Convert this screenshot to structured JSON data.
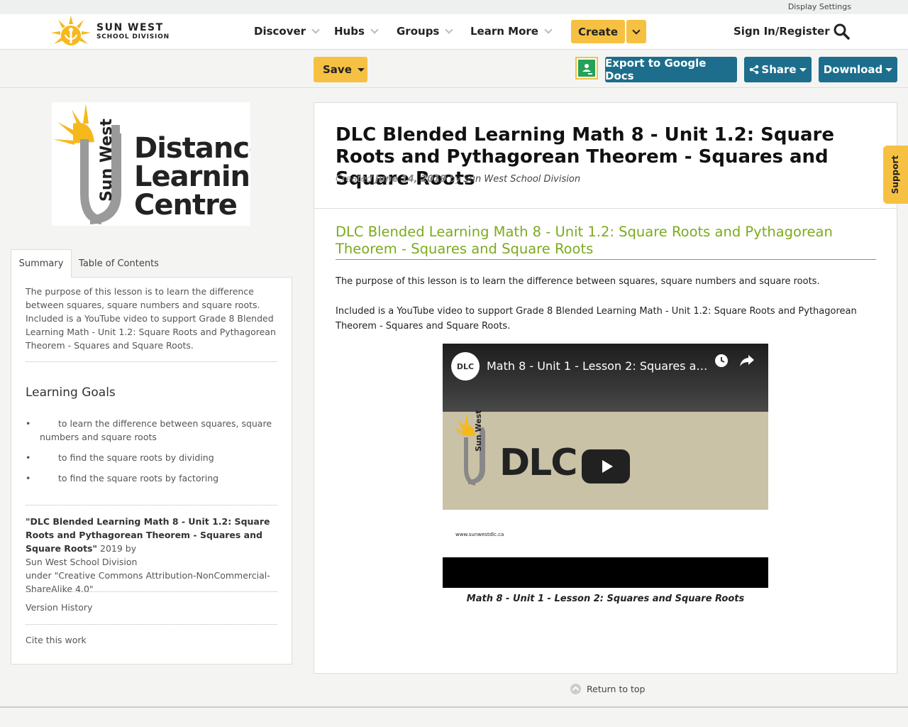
{
  "topbar": {
    "display_settings": "Display Settings"
  },
  "logo": {
    "line1": "SUN WEST",
    "line2": "SCHOOL DIVISION"
  },
  "nav": {
    "discover": "Discover",
    "hubs": "Hubs",
    "groups": "Groups",
    "learn_more": "Learn More",
    "create": "Create",
    "signin": "Sign In/Register"
  },
  "toolbar": {
    "save": "Save",
    "export": "Export to Google Docs",
    "share": "Share",
    "download": "Download"
  },
  "dlc_logo": {
    "sun_west": "Sun West",
    "line1": "Distance",
    "line2": "Learning",
    "line3": "Centre"
  },
  "tabs": {
    "summary": "Summary",
    "toc": "Table of Contents"
  },
  "sidebar": {
    "summary_text": "The purpose of this lesson is to learn the difference between squares, square numbers and square roots. Included is a YouTube video to support Grade 8 Blended Learning Math - Unit 1.2: Square Roots and Pythagorean Theorem - Squares and Square Roots.",
    "learning_goals_title": "Learning Goals",
    "goals": [
      "to learn the difference between squares, square numbers and square roots",
      "to find the square roots by dividing",
      "to find the square roots by factoring"
    ],
    "license_title": "\"DLC Blended Learning Math 8 - Unit 1.2: Square Roots and Pythagorean Theorem - Squares and Square Roots\"",
    "license_year_by": " 2019 by",
    "license_author": "Sun West School Division",
    "license_under": "under \"Creative Commons Attribution-NonCommercial-ShareAlike 4.0\"",
    "version_history": "Version History",
    "cite": "Cite this work"
  },
  "main": {
    "title": "DLC Blended Learning Math 8 - Unit 1.2: Square Roots and Pythagorean Theorem - Squares and Square Roots",
    "created_label": "Created",
    "created_date": "June 14, 2019",
    "by": "by",
    "author": "Sun West School Division",
    "section_title": "DLC Blended Learning Math 8 - Unit 1.2: Square Roots and Pythagorean Theorem - Squares and Square Roots",
    "para1": "The purpose of this lesson is to learn the difference between squares, square numbers and square roots.",
    "para2": "Included is a YouTube video to support Grade 8 Blended Learning Math - Unit 1.2: Square Roots and Pythagorean Theorem - Squares and Square Roots.",
    "video_title": "Math 8 - Unit 1 - Lesson 2: Squares and Square Roots",
    "video_avatar": "DLC",
    "video_brand": "DLC",
    "video_sun_west": "Sun West",
    "video_url": "www.sunwestdlc.ca",
    "caption": "Math 8 - Unit 1 - Lesson 2: Squares and Square Roots"
  },
  "support": "Support",
  "return_top": "Return to top",
  "colors": {
    "accent_yellow": "#f6c142",
    "button_blue": "#1c6e8c",
    "heading_green": "#7cab1c"
  }
}
